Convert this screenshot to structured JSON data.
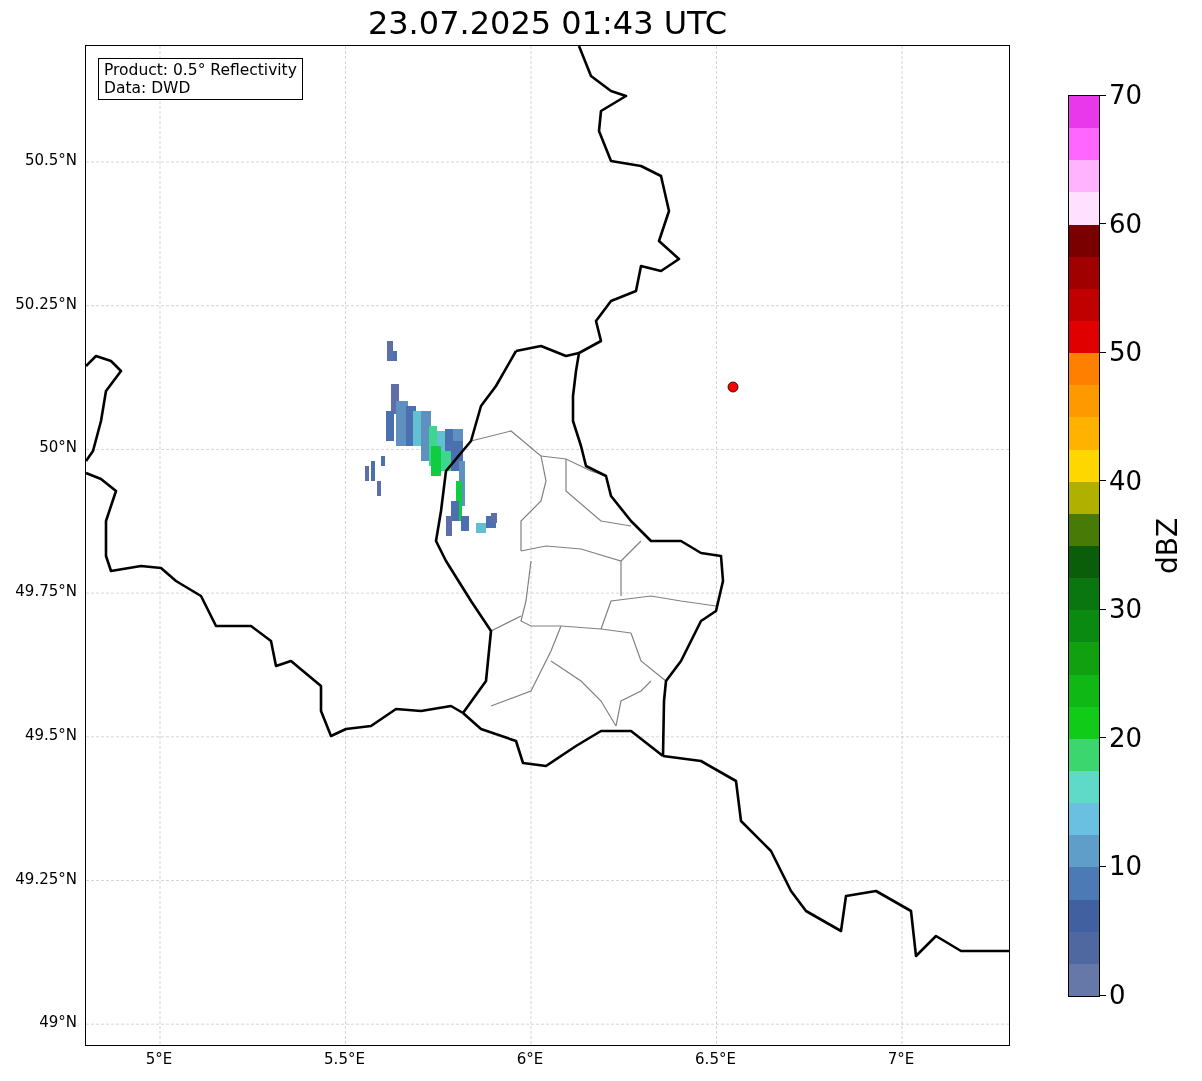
{
  "title": "23.07.2025 01:43 UTC",
  "info_box": {
    "lines": [
      "Product: 0.5° Reflectivity",
      "Data: DWD"
    ]
  },
  "lat_ticks": [
    "50.5°N",
    "50.25°N",
    "50°N",
    "49.75°N",
    "49.5°N",
    "49.25°N",
    "49°N"
  ],
  "lon_ticks": [
    "5°E",
    "5.5°E",
    "6°E",
    "6.5°E",
    "7°E"
  ],
  "colorbar": {
    "label": "dBZ",
    "ticks": [
      "70",
      "60",
      "50",
      "40",
      "30",
      "20",
      "10",
      "0"
    ],
    "segments": [
      {
        "color": "#e938e9"
      },
      {
        "color": "#ff66ff"
      },
      {
        "color": "#ffb3ff"
      },
      {
        "color": "#ffe0ff"
      },
      {
        "color": "#7a0000"
      },
      {
        "color": "#a00000"
      },
      {
        "color": "#c00000"
      },
      {
        "color": "#e00000"
      },
      {
        "color": "#ff8000"
      },
      {
        "color": "#ff9900"
      },
      {
        "color": "#ffb300"
      },
      {
        "color": "#ffd700"
      },
      {
        "color": "#b0b000"
      },
      {
        "color": "#487a08"
      },
      {
        "color": "#0a5e0a"
      },
      {
        "color": "#0a760f"
      },
      {
        "color": "#0a8a10"
      },
      {
        "color": "#10a010"
      },
      {
        "color": "#10b815"
      },
      {
        "color": "#10cc18"
      },
      {
        "color": "#3cd66e"
      },
      {
        "color": "#5fd9c8"
      },
      {
        "color": "#6ac0e0"
      },
      {
        "color": "#5e9ec8"
      },
      {
        "color": "#4b7ab4"
      },
      {
        "color": "#4060a0"
      },
      {
        "color": "#5068a0"
      },
      {
        "color": "#6678a8"
      }
    ]
  }
}
